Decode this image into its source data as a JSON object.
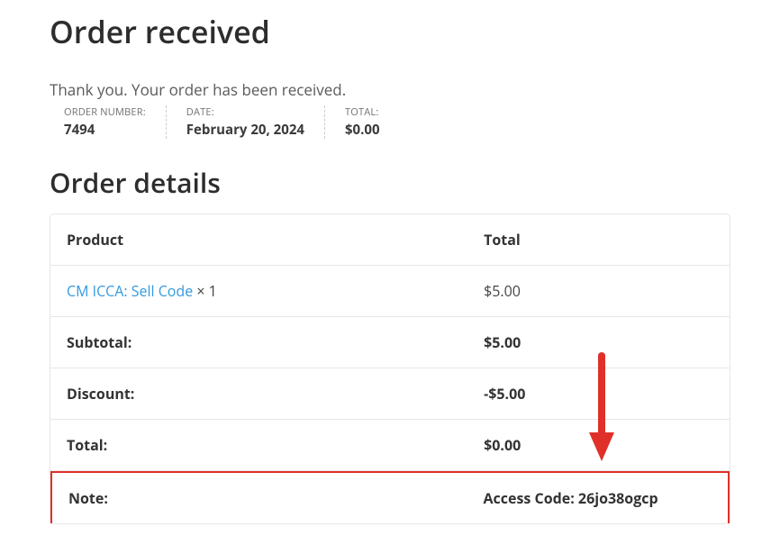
{
  "page": {
    "title": "Order received",
    "thanks": "Thank you. Your order has been received."
  },
  "meta": {
    "orderNumberLabel": "ORDER NUMBER:",
    "orderNumberValue": "7494",
    "dateLabel": "DATE:",
    "dateValue": "February 20, 2024",
    "totalLabel": "TOTAL:",
    "totalValue": "$0.00"
  },
  "section": {
    "detailsTitle": "Order details"
  },
  "table": {
    "head": {
      "product": "Product",
      "total": "Total"
    },
    "product": {
      "name": "CM ICCA: Sell Code",
      "qty": "× 1",
      "total": "$5.00"
    },
    "subtotalLabel": "Subtotal:",
    "subtotalValue": "$5.00",
    "discountLabel": "Discount:",
    "discountValue": "-$5.00",
    "totalLabel": "Total:",
    "totalValue": "$0.00",
    "noteLabel": "Note:",
    "noteValue": "Access Code: 26jo38ogcp"
  },
  "annotation": {
    "arrowColor": "#e0302a"
  }
}
